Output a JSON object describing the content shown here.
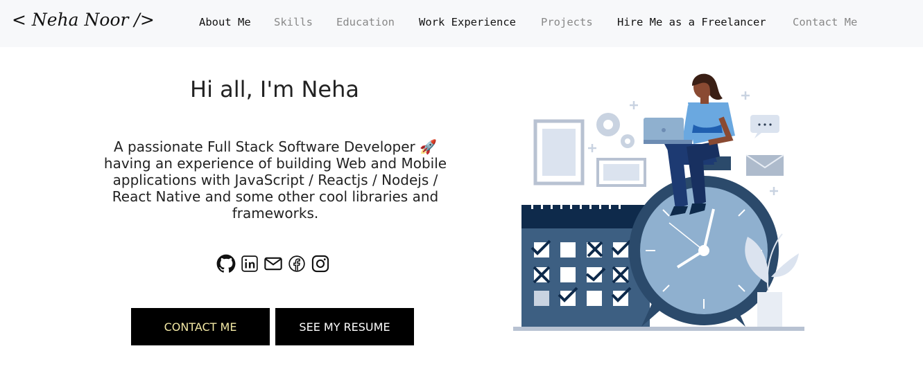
{
  "logo": "< Neha Noor />",
  "nav": {
    "items": [
      {
        "label": "About Me"
      },
      {
        "label": "Skills"
      },
      {
        "label": "Education"
      },
      {
        "label": "Work Experience"
      },
      {
        "label": "Projects"
      },
      {
        "label": "Hire Me as a Freelancer"
      },
      {
        "label": "Contact Me"
      }
    ]
  },
  "hero": {
    "title": "Hi all, I'm Neha",
    "bio": "A passionate Full Stack Software Developer 🚀 having an experience of building Web and Mobile applications with JavaScript / Reactjs / Nodejs / React Native and some other cool libraries and frameworks.",
    "socials": [
      {
        "icon": "github-icon"
      },
      {
        "icon": "linkedin-icon"
      },
      {
        "icon": "mail-icon"
      },
      {
        "icon": "facebook-icon"
      },
      {
        "icon": "instagram-icon"
      }
    ],
    "buttons": {
      "contact": "CONTACT ME",
      "resume": "SEE MY RESUME"
    }
  },
  "colors": {
    "nav_bg": "#f7f8fa",
    "button_bg": "#000000",
    "contact_text": "#f3e9a5",
    "illustration_dark": "#2b4a6b",
    "illustration_light": "#8fb0cf"
  }
}
